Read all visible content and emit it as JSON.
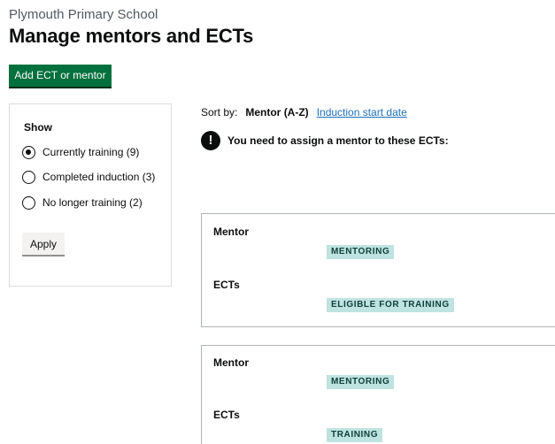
{
  "header": {
    "caption": "Plymouth Primary School",
    "title": "Manage mentors and ECTs"
  },
  "actions": {
    "add_label": "Add ECT or mentor"
  },
  "filter": {
    "heading": "Show",
    "options": [
      {
        "label": "Currently training (9)",
        "checked": true
      },
      {
        "label": "Completed induction (3)",
        "checked": false
      },
      {
        "label": "No longer training (2)",
        "checked": false
      }
    ],
    "apply_label": "Apply"
  },
  "sort": {
    "label": "Sort by:",
    "current": "Mentor (A-Z)",
    "alternative": "Induction start date"
  },
  "warning": {
    "icon": "!",
    "text": "You need to assign a mentor to these ECTs:"
  },
  "cards": [
    {
      "mentor_heading": "Mentor",
      "mentor_tag": "MENTORING",
      "ects_heading": "ECTs",
      "ects_tag": "ELIGIBLE FOR TRAINING"
    },
    {
      "mentor_heading": "Mentor",
      "mentor_tag": "MENTORING",
      "ects_heading": "ECTs",
      "ects_tag": "TRAINING"
    }
  ],
  "colors": {
    "primary_button": "#00703c",
    "link": "#1d70b8",
    "tag_bg": "#bfe3e0",
    "tag_text": "#10403c"
  }
}
